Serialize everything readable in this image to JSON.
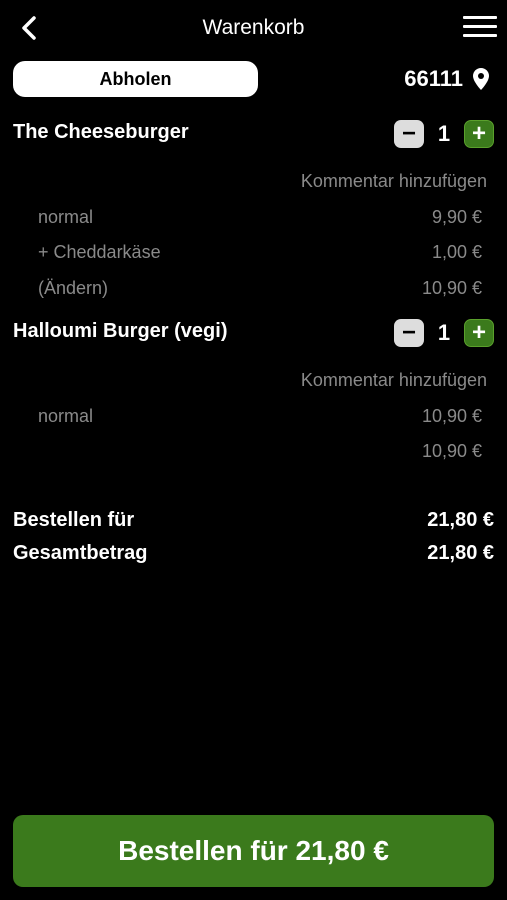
{
  "header": {
    "title": "Warenkorb",
    "back_icon": "chevron-left-icon",
    "menu_icon": "hamburger-menu-icon"
  },
  "delivery": {
    "mode_label": "Abholen",
    "zip": "66111",
    "location_icon": "map-pin-icon"
  },
  "items": [
    {
      "name": "The Cheeseburger",
      "quantity": "1",
      "comment_label": "Kommentar hinzufügen",
      "lines": [
        {
          "label": "normal",
          "price": "9,90 €"
        },
        {
          "label": "+ Cheddarkäse",
          "price": "1,00 €"
        },
        {
          "label": "(Ändern)",
          "price": "10,90 €"
        }
      ]
    },
    {
      "name": "Halloumi Burger (vegi)",
      "quantity": "1",
      "comment_label": "Kommentar hinzufügen",
      "lines": [
        {
          "label": "normal",
          "price": "10,90 €"
        },
        {
          "label": "",
          "price": "10,90 €"
        }
      ]
    }
  ],
  "summary": {
    "order_for_label": "Bestellen für",
    "order_for_value": "21,80 €",
    "total_label": "Gesamtbetrag",
    "total_value": "21,80 €"
  },
  "order_button": {
    "label": "Bestellen für 21,80 €"
  },
  "colors": {
    "accent_green": "#3b7a1c",
    "muted_text": "#8a8a8a",
    "background": "#000000"
  }
}
